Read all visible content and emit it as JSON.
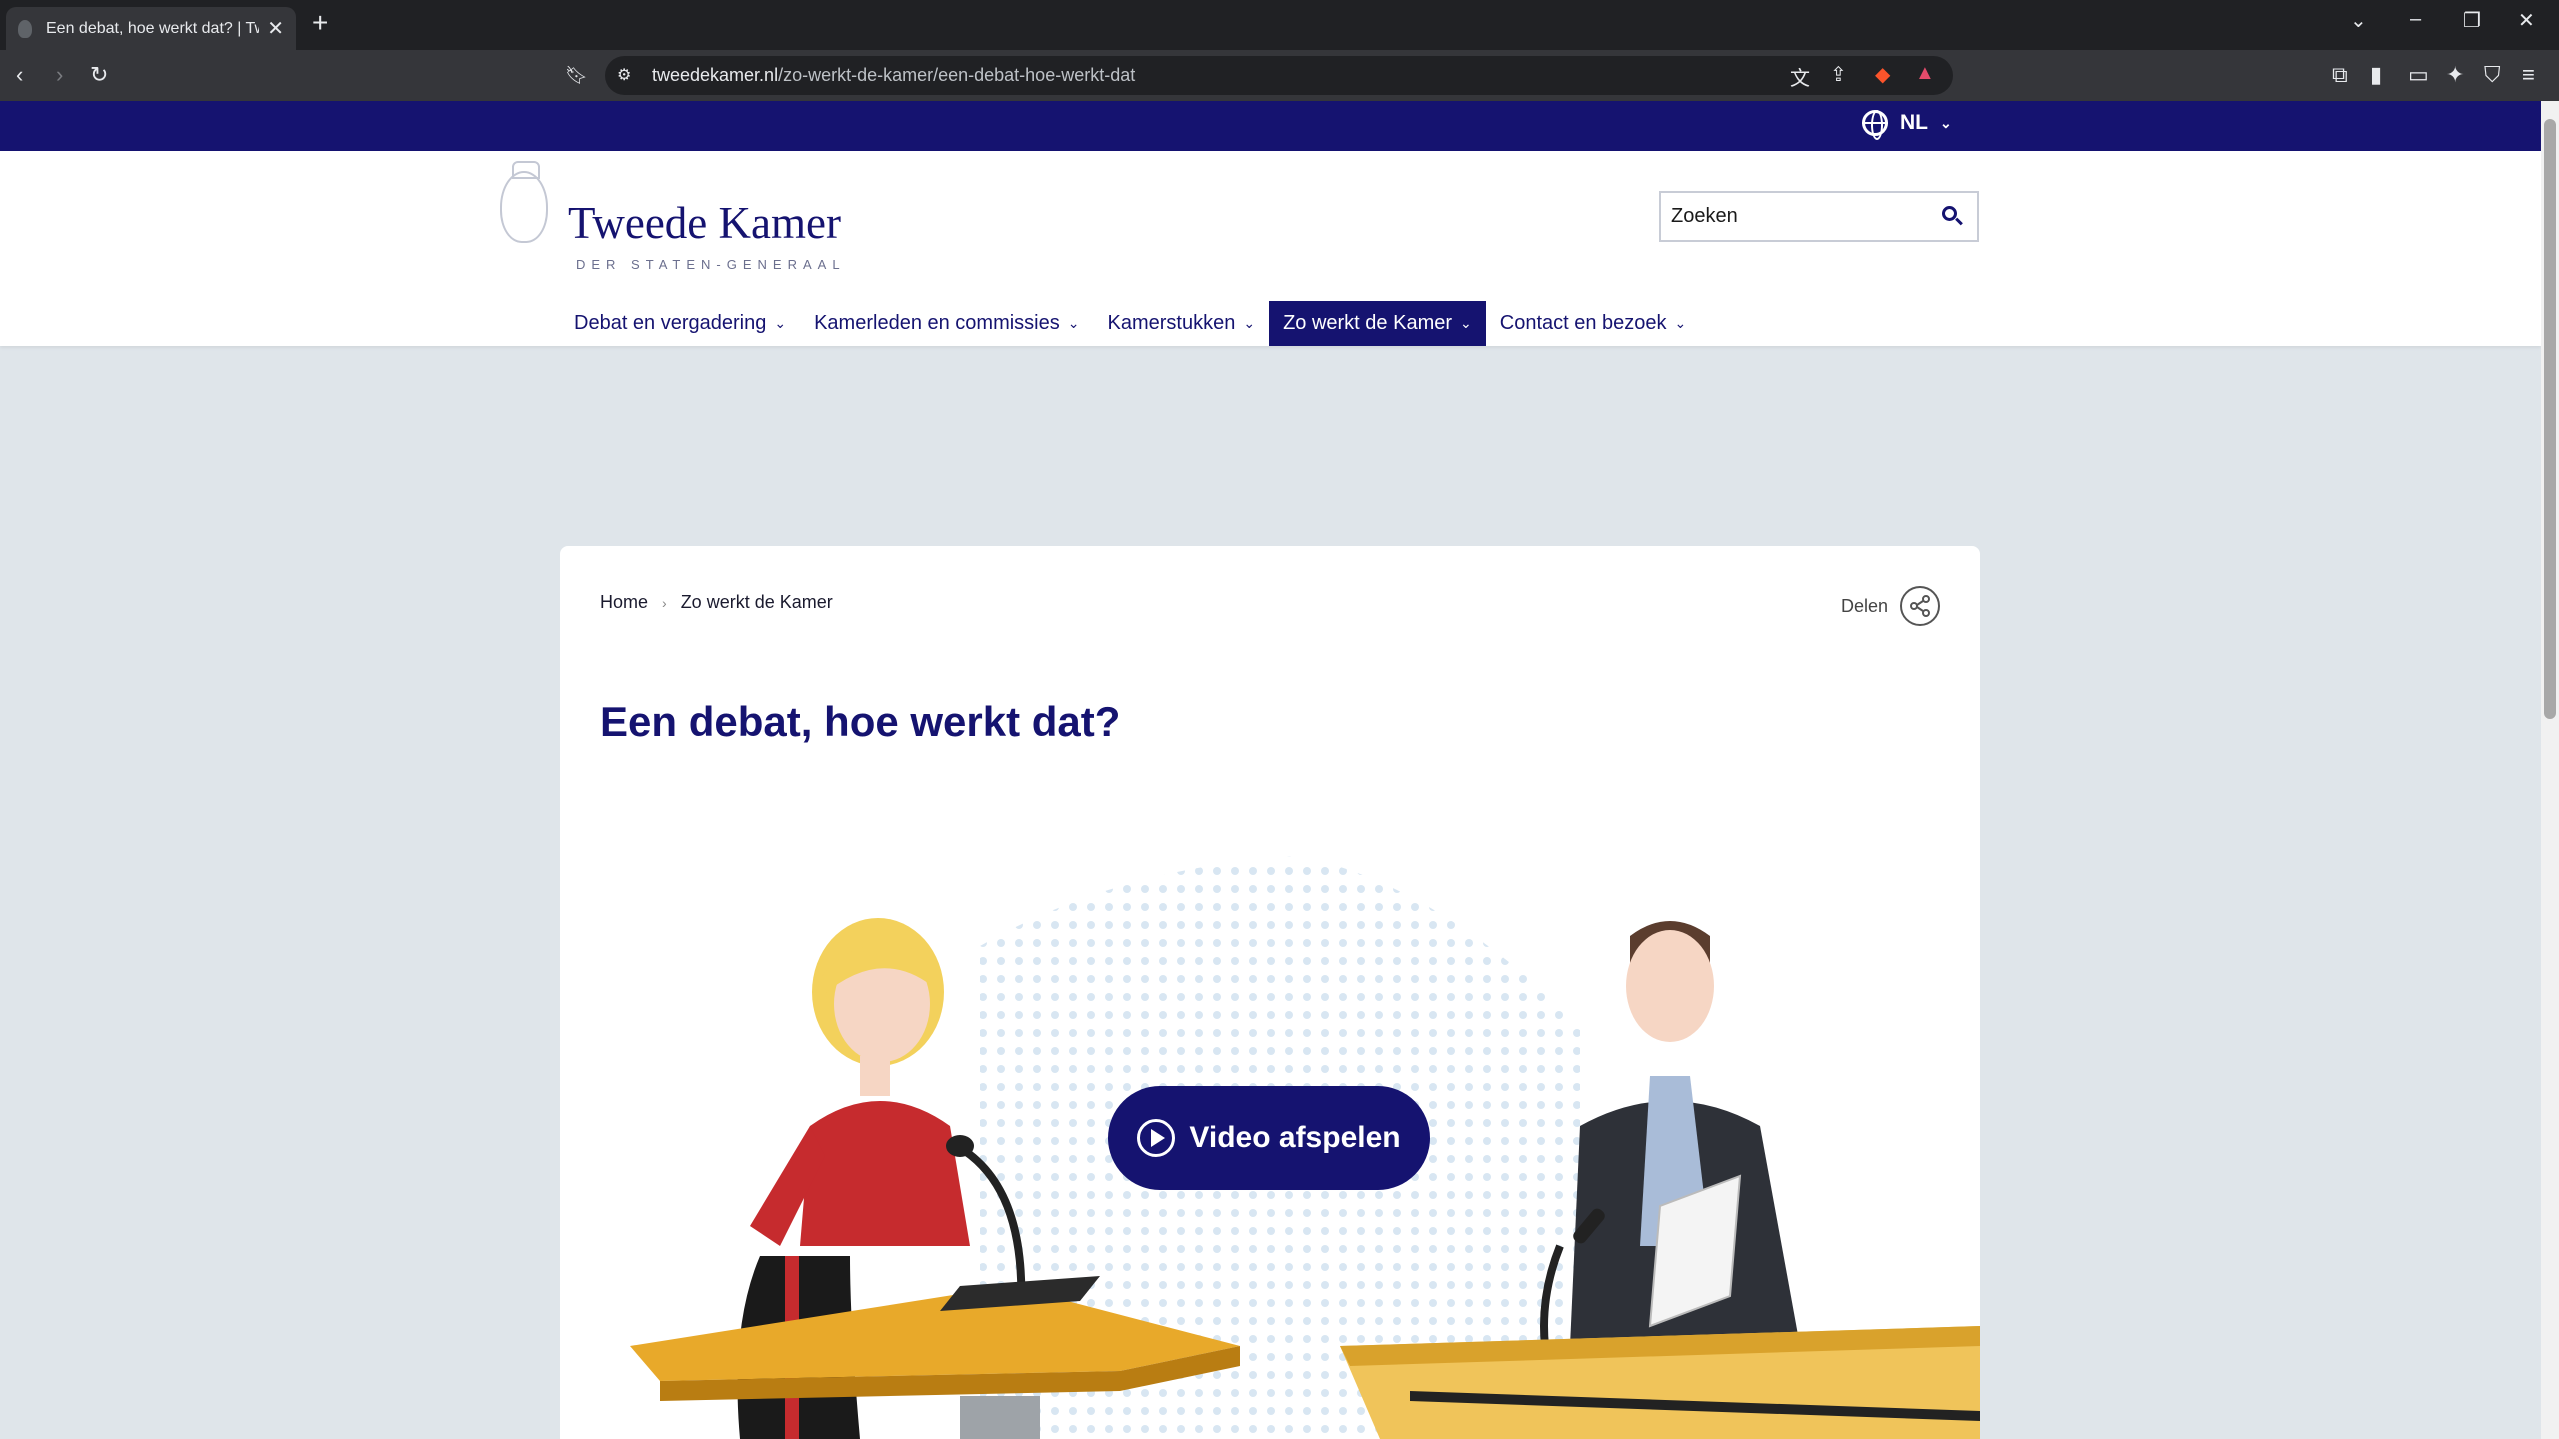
{
  "browser": {
    "tab_title": "Een debat, hoe werkt dat? | Tweede Kamer",
    "url_domain": "tweedekamer.nl",
    "url_path": "/zo-werkt-de-kamer/een-debat-hoe-werkt-dat"
  },
  "topbar": {
    "language": "NL"
  },
  "logo": {
    "name": "Tweede Kamer",
    "subtitle": "DER STATEN-GENERAAL"
  },
  "search": {
    "placeholder": "Zoeken"
  },
  "nav": [
    {
      "label": "Debat en vergadering"
    },
    {
      "label": "Kamerleden en commissies"
    },
    {
      "label": "Kamerstukken"
    },
    {
      "label": "Zo werkt de Kamer",
      "active": true
    },
    {
      "label": "Contact en bezoek"
    }
  ],
  "breadcrumb": [
    "Home",
    "Zo werkt de Kamer"
  ],
  "share_label": "Delen",
  "page_title": "Een debat, hoe werkt dat?",
  "video_button": "Video afspelen",
  "colors": {
    "brand": "#151370",
    "page_bg": "#dfe5ea",
    "podium": "#e8a92a"
  }
}
